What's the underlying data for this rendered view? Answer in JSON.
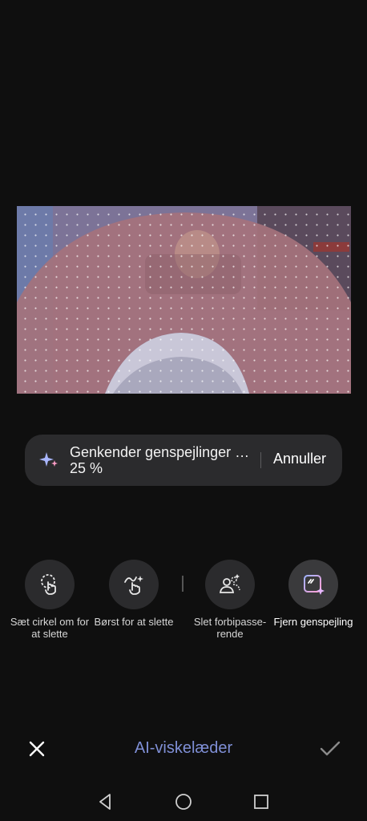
{
  "progress": {
    "text": "Genkender genspejlinger … 25 %",
    "percent": 25,
    "cancel_label": "Annuller"
  },
  "tools": [
    {
      "label": "Sæt cirkel om for at slette",
      "icon": "circle-select-icon"
    },
    {
      "label": "Børst for at slette",
      "icon": "brush-erase-icon"
    },
    {
      "label": "Slet forbipasse­rende",
      "icon": "passersby-icon"
    },
    {
      "label": "Fjern genspej­ling",
      "icon": "reflection-remove-icon",
      "active": true
    }
  ],
  "bottom": {
    "title": "AI-viskelæder"
  },
  "nav": {
    "back": "back-icon",
    "home": "home-icon",
    "recents": "recents-icon"
  },
  "colors": {
    "background": "#0f0f0f",
    "accent_title": "#7f8fd6",
    "pill": "#2b2b2d"
  }
}
